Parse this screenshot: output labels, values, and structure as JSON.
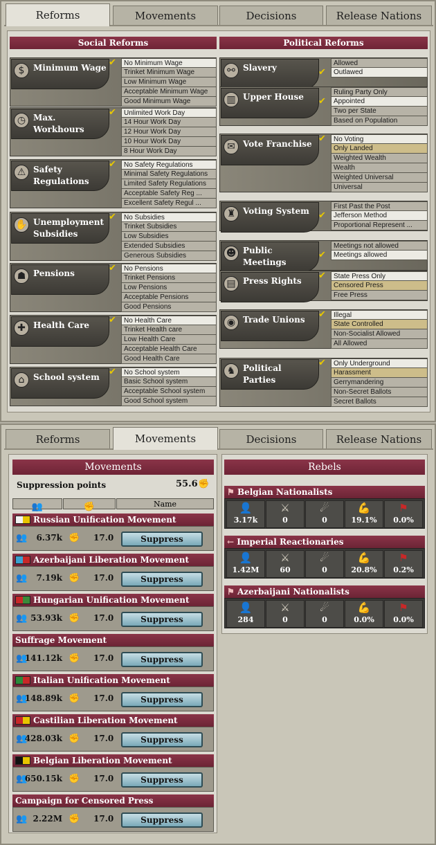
{
  "tabs": [
    "Reforms",
    "Movements",
    "Decisions",
    "Release Nations"
  ],
  "reforms": {
    "social_header": "Social Reforms",
    "political_header": "Political Reforms",
    "social": [
      {
        "name": "Minimum Wage",
        "icon": "coin-icon",
        "options": [
          "No Minimum Wage",
          "Trinket Minimum Wage",
          "Low Minimum Wage",
          "Acceptable Minimum Wage",
          "Good Minimum Wage"
        ],
        "current": 0
      },
      {
        "name": "Max. Workhours",
        "icon": "clock-icon",
        "options": [
          "Unlimited Work Day",
          "14 Hour Work Day",
          "12 Hour Work Day",
          "10 Hour Work Day",
          "8 Hour Work Day"
        ],
        "current": 0
      },
      {
        "name": "Safety Regulations",
        "icon": "warning-icon",
        "options": [
          "No Safety Regulations",
          "Minimal Safety Regulations",
          "Limited Safety Regulations",
          "Acceptable Safety Reg ...",
          "Excellent Safety Regul ..."
        ],
        "current": 0
      },
      {
        "name": "Unemployment Subsidies",
        "icon": "hand-coin-icon",
        "options": [
          "No Subsidies",
          "Trinket Subsidies",
          "Low Subsidies",
          "Extended Subsidies",
          "Generous Subsidies"
        ],
        "current": 0
      },
      {
        "name": "Pensions",
        "icon": "elder-icon",
        "options": [
          "No Pensions",
          "Trinket Pensions",
          "Low Pensions",
          "Acceptable Pensions",
          "Good Pensions"
        ],
        "current": 0
      },
      {
        "name": "Health Care",
        "icon": "medkit-icon",
        "options": [
          "No Health Care",
          "Trinket Health care",
          "Low Health Care",
          "Acceptable Health Care",
          "Good Health Care"
        ],
        "current": 0
      },
      {
        "name": "School system",
        "icon": "school-icon",
        "options": [
          "No School system",
          "Basic School system",
          "Acceptable School system",
          "Good School system"
        ],
        "current": 0
      }
    ],
    "political": [
      {
        "name": "Slavery",
        "icon": "chain-icon",
        "options": [
          "Allowed",
          "Outlawed"
        ],
        "current": 1,
        "highlight": -1
      },
      {
        "name": "Upper House",
        "icon": "chart-icon",
        "options": [
          "Ruling Party Only",
          "Appointed",
          "Two per State",
          "Based on Population"
        ],
        "current": 1,
        "highlight": -1
      },
      {
        "name": "Vote Franchise",
        "icon": "ballot-icon",
        "options": [
          "No Voting",
          "Only Landed",
          "Weighted Wealth",
          "Wealth",
          "Weighted Universal",
          "Universal"
        ],
        "current": 0,
        "highlight": 1
      },
      {
        "name": "Voting System",
        "icon": "chair-icon",
        "options": [
          "First Past the Post",
          "Jefferson Method",
          "Proportional Represent ..."
        ],
        "current": 1,
        "highlight": -1
      },
      {
        "name": "Public Meetings",
        "icon": "crowd-icon",
        "options": [
          "Meetings not allowed",
          "Meetings allowed"
        ],
        "current": 1,
        "highlight": -1
      },
      {
        "name": "Press Rights",
        "icon": "newspaper-icon",
        "options": [
          "State Press Only",
          "Censored Press",
          "Free Press"
        ],
        "current": 0,
        "highlight": 1
      },
      {
        "name": "Trade Unions",
        "icon": "union-icon",
        "options": [
          "Illegal",
          "State Controlled",
          "Non-Socialist Allowed",
          "All Allowed"
        ],
        "current": 0,
        "highlight": 1
      },
      {
        "name": "Political Parties",
        "icon": "elephant-icon",
        "options": [
          "Only Underground",
          "Harassment",
          "Gerrymandering",
          "Non-Secret Ballots",
          "Secret Ballots"
        ],
        "current": 0,
        "highlight": 1
      }
    ]
  },
  "movements": {
    "header": "Movements",
    "suppression_label": "Suppression points",
    "suppression_value": "55.6",
    "col_name": "Name",
    "suppress_label": "Suppress",
    "items": [
      {
        "name": "Russian Unification Movement",
        "size": "6.37k",
        "radicalism": "17.0",
        "flag": "#f2f2f2",
        "flag2": "#e8c400"
      },
      {
        "name": "Azerbaijani Liberation Movement",
        "size": "7.19k",
        "radicalism": "17.0",
        "flag": "#3aa0d0",
        "flag2": "#c82828"
      },
      {
        "name": "Hungarian Unification Movement",
        "size": "53.93k",
        "radicalism": "17.0",
        "flag": "#c82828",
        "flag2": "#3a8a3a"
      },
      {
        "name": "Suffrage Movement",
        "size": "141.12k",
        "radicalism": "17.0",
        "flag": "",
        "flag2": ""
      },
      {
        "name": "Italian Unification Movement",
        "size": "148.89k",
        "radicalism": "17.0",
        "flag": "#2a8a3a",
        "flag2": "#c82828"
      },
      {
        "name": "Castilian Liberation Movement",
        "size": "428.03k",
        "radicalism": "17.0",
        "flag": "#c82828",
        "flag2": "#e8c400"
      },
      {
        "name": "Belgian Liberation Movement",
        "size": "650.15k",
        "radicalism": "17.0",
        "flag": "#111111",
        "flag2": "#e8c400"
      },
      {
        "name": "Campaign for Censored Press",
        "size": "2.22M",
        "radicalism": "17.0",
        "flag": "",
        "flag2": ""
      }
    ]
  },
  "rebels": {
    "header": "Rebels",
    "items": [
      {
        "name": "Belgian Nationalists",
        "icon": "banner-icon",
        "stats": [
          "3.17k",
          "0",
          "0",
          "19.1%",
          "0.0%"
        ]
      },
      {
        "name": "Imperial Reactionaries",
        "icon": "arrow-left-icon",
        "stats": [
          "1.42M",
          "60",
          "0",
          "20.8%",
          "0.2%"
        ]
      },
      {
        "name": "Azerbaijani Nationalists",
        "icon": "banner-icon",
        "stats": [
          "284",
          "0",
          "0",
          "0.0%",
          "0.0%"
        ]
      }
    ]
  }
}
